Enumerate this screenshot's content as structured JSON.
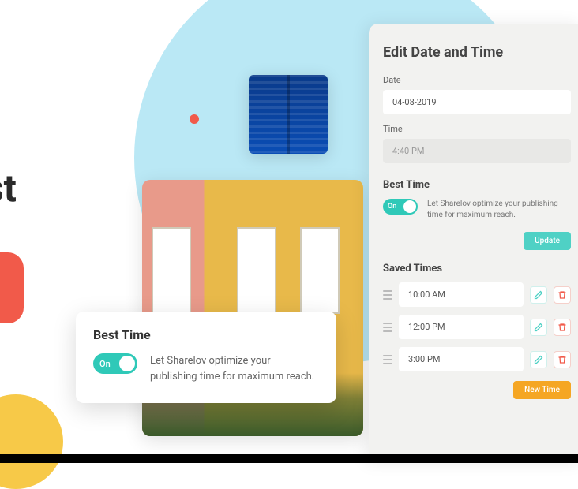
{
  "heading_fragment": "st",
  "card": {
    "title": "Best Time",
    "toggle_state": "On",
    "description": "Let Sharelov optimize your publishing time for maximum reach."
  },
  "panel": {
    "title": "Edit Date and Time",
    "date_label": "Date",
    "date_value": "04-08-2019",
    "time_label": "Time",
    "time_value": "4:40 PM",
    "best_title": "Best Time",
    "best_toggle": "On",
    "best_description": "Let Sharelov optimize your publishing time for maximum reach.",
    "update_label": "Update",
    "saved_title": "Saved Times",
    "saved": [
      {
        "time": "10:00 AM"
      },
      {
        "time": "12:00 PM"
      },
      {
        "time": "3:00 PM"
      }
    ],
    "new_time_label": "New Time"
  }
}
